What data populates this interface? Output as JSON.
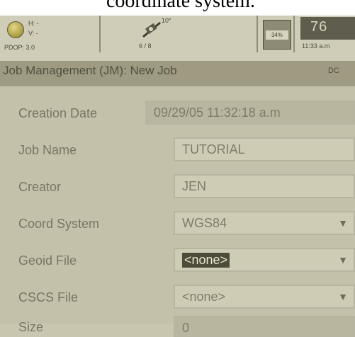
{
  "caption": {
    "text": "coordinate system."
  },
  "status_bar": {
    "h_value": "H: -",
    "v_value": "V: -",
    "pdop": "PDOP: 3.0",
    "satellites": "6 / 8",
    "elevation_mask": "10°",
    "memory": "34%",
    "battery": "76",
    "clock": "11:33 a.m"
  },
  "title_bar": {
    "title": "Job Management (JM): New Job",
    "mode": "DC"
  },
  "fields": {
    "creation_date": {
      "label": "Creation Date",
      "value": "09/29/05 11:32:18 a.m"
    },
    "job_name": {
      "label": "Job Name",
      "value": "TUTORIAL"
    },
    "creator": {
      "label": "Creator",
      "value": "JEN"
    },
    "coord_system": {
      "label": "Coord System",
      "value": "WGS84"
    },
    "geoid_file": {
      "label": "Geoid File",
      "value": "<none>"
    },
    "cscs_file": {
      "label": "CSCS File",
      "value": "<none>"
    },
    "size": {
      "label": "Size",
      "value": "0"
    }
  },
  "icons": {
    "gps_status": "gps-status-icon",
    "satellite": "satellite-icon",
    "memory": "memory-card-icon",
    "battery": "battery-icon",
    "dropdown": "chevron-down-icon"
  },
  "colors": {
    "screen_background": "#c4c1aa",
    "title_bar": "#9e9b82",
    "selection": "#4d4b3a"
  }
}
